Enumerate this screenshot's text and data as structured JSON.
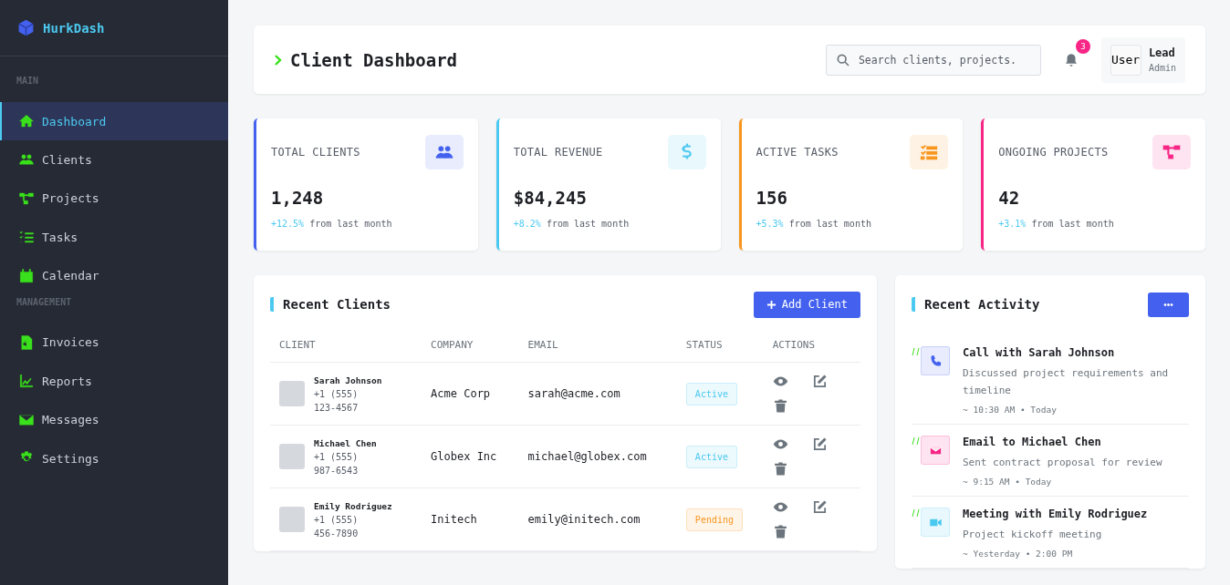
{
  "brand": "HurkDash",
  "sidebar": {
    "sections": [
      {
        "title": "MAIN",
        "items": [
          {
            "label": "Dashboard",
            "selected": true
          },
          {
            "label": "Clients",
            "selected": false
          },
          {
            "label": "Projects",
            "selected": false
          },
          {
            "label": "Tasks",
            "selected": false
          },
          {
            "label": "Calendar",
            "selected": false
          }
        ]
      },
      {
        "title": "MANAGEMENT",
        "items": [
          {
            "label": "Invoices",
            "selected": false
          },
          {
            "label": "Reports",
            "selected": false
          },
          {
            "label": "Messages",
            "selected": false
          },
          {
            "label": "Settings",
            "selected": false
          }
        ]
      }
    ]
  },
  "header": {
    "title": "Client Dashboard",
    "search": {
      "placeholder": "Search clients, projects."
    },
    "notifications": "3",
    "user": {
      "avatar": "User",
      "name": "Lead",
      "role": "Admin"
    }
  },
  "stats": [
    {
      "label": "TOTAL CLIENTS",
      "value": "1,248",
      "change": "+12.5%",
      "note": "from last month",
      "color": "#4361ee"
    },
    {
      "label": "TOTAL REVENUE",
      "value": "$84,245",
      "change": "+8.2%",
      "note": "from last month",
      "color": "#4cc9f0"
    },
    {
      "label": "ACTIVE TASKS",
      "value": "156",
      "change": "+5.3%",
      "note": "from last month",
      "color": "#f8961e"
    },
    {
      "label": "ONGOING PROJECTS",
      "value": "42",
      "change": "+3.1%",
      "note": "from last month",
      "color": "#f72585"
    }
  ],
  "clients": {
    "title": "Recent Clients",
    "add_button": "Add Client",
    "columns": [
      "CLIENT",
      "COMPANY",
      "EMAIL",
      "STATUS",
      "ACTIONS"
    ],
    "rows": [
      {
        "name": "Sarah Johnson",
        "phone": "+1 (555)",
        "phone_2": "123-4567",
        "company": "Acme Corp",
        "email": "sarah@acme.com",
        "status": "Active",
        "kind": "active"
      },
      {
        "name": "Michael Chen",
        "phone": "+1 (555)",
        "phone_2": "987-6543",
        "company": "Globex Inc",
        "email": "michael@globex.com",
        "status": "Active",
        "kind": "active"
      },
      {
        "name": "Emily Rodriguez",
        "phone": "+1 (555)",
        "phone_2": "456-7890",
        "company": "Initech",
        "email": "emily@initech.com",
        "status": "Pending",
        "kind": "pending"
      }
    ]
  },
  "activity": {
    "title": "Recent Activity",
    "more_button": "•••",
    "items": [
      {
        "title": "Call with Sarah Johnson",
        "text": "Discussed project requirements and timeline",
        "time": "~ 10:30 AM • Today",
        "color": "#4361ee",
        "kind": "call"
      },
      {
        "title": "Email to Michael Chen",
        "text": "Sent contract proposal for review",
        "time": "~ 9:15 AM • Today",
        "color": "#f72585",
        "kind": "email"
      },
      {
        "title": "Meeting with Emily Rodriguez",
        "text": "Project kickoff meeting",
        "time": "~ Yesterday • 2:00 PM",
        "color": "#4cc9f0",
        "kind": "meeting"
      }
    ]
  }
}
